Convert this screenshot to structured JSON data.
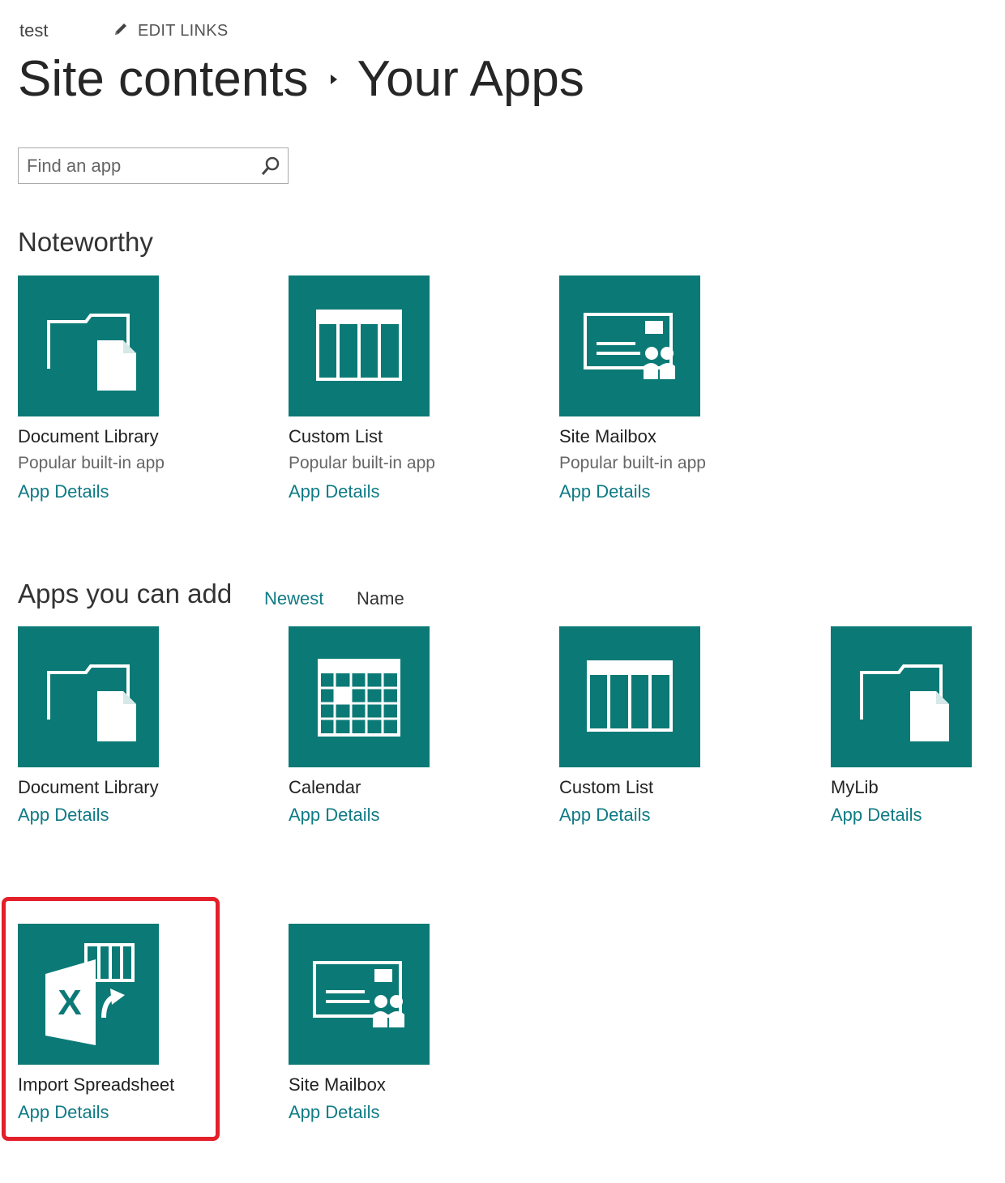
{
  "header": {
    "site_name": "test",
    "edit_links_label": "EDIT LINKS",
    "breadcrumb_root": "Site contents",
    "breadcrumb_current": "Your Apps"
  },
  "search": {
    "placeholder": "Find an app"
  },
  "noteworthy": {
    "title": "Noteworthy",
    "tiles": [
      {
        "name": "Document Library",
        "desc": "Popular built-in app",
        "details": "App Details",
        "icon": "document-library-icon"
      },
      {
        "name": "Custom List",
        "desc": "Popular built-in app",
        "details": "App Details",
        "icon": "custom-list-icon"
      },
      {
        "name": "Site Mailbox",
        "desc": "Popular built-in app",
        "details": "App Details",
        "icon": "site-mailbox-icon"
      }
    ]
  },
  "apps": {
    "title": "Apps you can add",
    "sort_newest": "Newest",
    "sort_name": "Name",
    "tiles": [
      {
        "name": "Document Library",
        "details": "App Details",
        "icon": "document-library-icon"
      },
      {
        "name": "Calendar",
        "details": "App Details",
        "icon": "calendar-icon"
      },
      {
        "name": "Custom List",
        "details": "App Details",
        "icon": "custom-list-icon"
      },
      {
        "name": "MyLib",
        "details": "App Details",
        "icon": "document-library-icon"
      },
      {
        "name": "Import Spreadsheet",
        "details": "App Details",
        "icon": "import-spreadsheet-icon"
      },
      {
        "name": "Site Mailbox",
        "details": "App Details",
        "icon": "site-mailbox-icon"
      }
    ]
  },
  "colors": {
    "tile": "#0b7a76",
    "link": "#0f7b85",
    "highlight": "#e3202a"
  }
}
